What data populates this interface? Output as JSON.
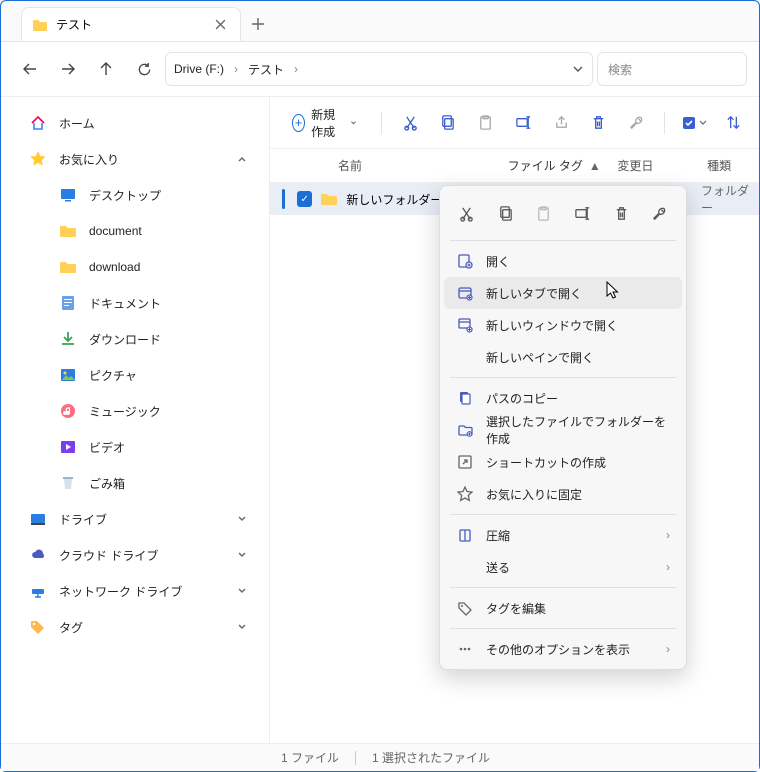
{
  "tab": {
    "title": "テスト"
  },
  "address": {
    "root": "Drive (F:)",
    "folder": "テスト"
  },
  "search": {
    "placeholder": "検索"
  },
  "sidebar": {
    "home": "ホーム",
    "favorites": "お気に入り",
    "items": [
      "デスクトップ",
      "document",
      "download",
      "ドキュメント",
      "ダウンロード",
      "ピクチャ",
      "ミュージック",
      "ビデオ",
      "ごみ箱"
    ],
    "drive": "ドライブ",
    "cloud_drive": "クラウド ドライブ",
    "network_drive": "ネットワーク ドライブ",
    "tag": "タグ"
  },
  "toolbar": {
    "new_label": "新規作成"
  },
  "columns": {
    "name": "名前",
    "filetag": "ファイル タグ",
    "modified": "変更日",
    "type": "種類"
  },
  "files": [
    {
      "name": "新しいフォルダー",
      "type": "フォルダー"
    }
  ],
  "context_menu": {
    "open": "開く",
    "open_new_tab": "新しいタブで開く",
    "open_new_window": "新しいウィンドウで開く",
    "open_new_pane": "新しいペインで開く",
    "copy_path": "パスのコピー",
    "create_folder_from_selection": "選択したファイルでフォルダーを作成",
    "create_shortcut": "ショートカットの作成",
    "pin_favorites": "お気に入りに固定",
    "compress": "圧縮",
    "send": "送る",
    "edit_tag": "タグを編集",
    "more_options": "その他のオプションを表示"
  },
  "status": {
    "count": "1 ファイル",
    "selected": "1 選択されたファイル"
  }
}
